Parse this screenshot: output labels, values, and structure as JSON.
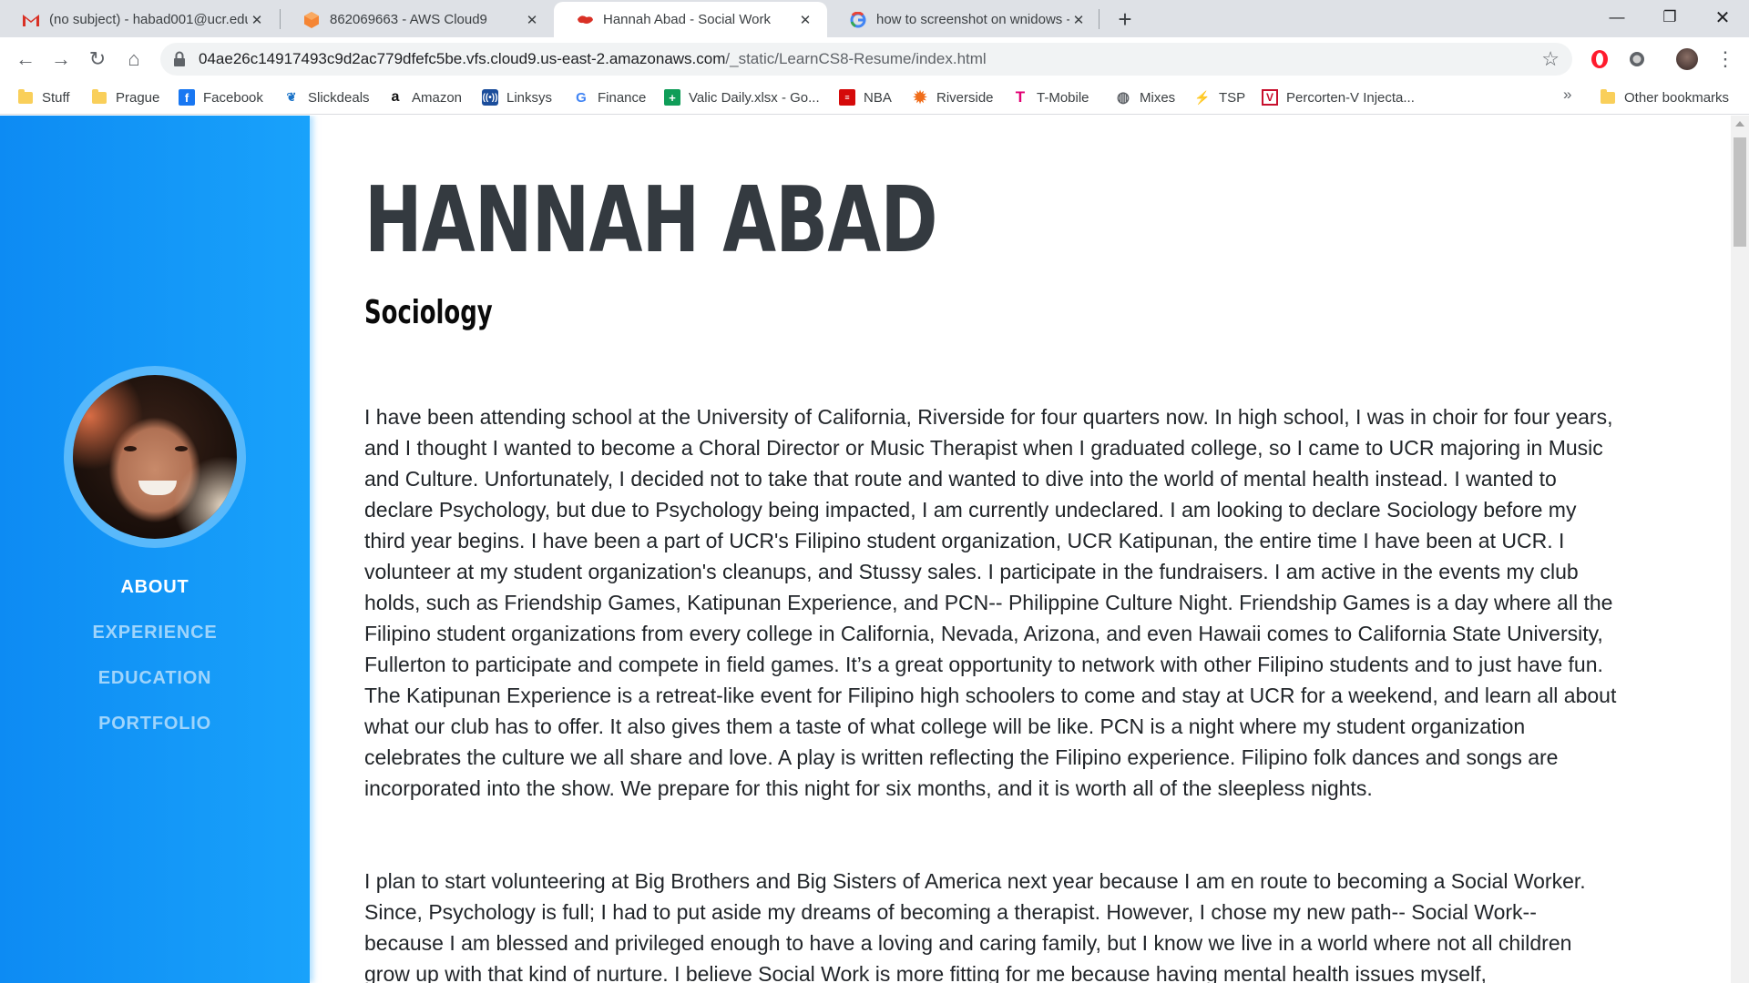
{
  "browser": {
    "tabs": [
      {
        "title": "(no subject) - habad001@ucr.edu",
        "icon": "gmail-icon"
      },
      {
        "title": "862069663 - AWS Cloud9",
        "icon": "cloud9-icon"
      },
      {
        "title": "Hannah Abad - Social Work",
        "icon": "site-favicon"
      },
      {
        "title": "how to screenshot on wnidows - ",
        "icon": "google-icon"
      }
    ],
    "url_host": "04ae26c14917493c9d2ac779dfefc5be.vfs.cloud9.us-east-2.amazonaws.com",
    "url_path": "/_static/LearnCS8-Resume/index.html",
    "bookmarks": [
      {
        "label": "Stuff",
        "icon": "folder-icon"
      },
      {
        "label": "Prague",
        "icon": "folder-icon"
      },
      {
        "label": "Facebook",
        "icon": "facebook-icon"
      },
      {
        "label": "Slickdeals",
        "icon": "slickdeals-icon"
      },
      {
        "label": "Amazon",
        "icon": "amazon-icon"
      },
      {
        "label": "Linksys",
        "icon": "linksys-icon"
      },
      {
        "label": "Finance",
        "icon": "google-icon"
      },
      {
        "label": "Valic Daily.xlsx - Go...",
        "icon": "sheets-icon"
      },
      {
        "label": "NBA",
        "icon": "nba-icon"
      },
      {
        "label": "Riverside",
        "icon": "riverside-icon"
      },
      {
        "label": "T-Mobile",
        "icon": "tmobile-icon"
      },
      {
        "label": "Mixes",
        "icon": "globe-icon"
      },
      {
        "label": "TSP",
        "icon": "tsp-icon"
      },
      {
        "label": "Percorten-V Injecta...",
        "icon": "percorten-icon"
      }
    ],
    "other_bookmarks": "Other bookmarks",
    "overflow": "»"
  },
  "sidebar": {
    "nav": [
      {
        "label": "ABOUT",
        "active": true
      },
      {
        "label": "EXPERIENCE",
        "active": false
      },
      {
        "label": "EDUCATION",
        "active": false
      },
      {
        "label": "PORTFOLIO",
        "active": false
      }
    ]
  },
  "main": {
    "name": "HANNAH ABAD",
    "subtitle": "Sociology",
    "paragraphs": [
      "I have been attending school at the University of California, Riverside for four quarters now. In high school, I was in choir for four years, and I thought I wanted to become a Choral Director or Music Therapist when I graduated college, so I came to UCR majoring in Music and Culture. Unfortunately, I decided not to take that route and wanted to dive into the world of mental health instead. I wanted to declare Psychology, but due to Psychology being impacted, I am currently undeclared. I am looking to declare Sociology before my third year begins. I have been a part of UCR's Filipino student organization, UCR Katipunan, the entire time I have been at UCR. I volunteer at my student organization's cleanups, and Stussy sales. I participate in the fundraisers. I am active in the events my club holds, such as Friendship Games, Katipunan Experience, and PCN-- Philippine Culture Night. Friendship Games is a day where all the Filipino student organizations from every college in California, Nevada, Arizona, and even Hawaii comes to California State University, Fullerton to participate and compete in field games. It’s a great opportunity to network with other Filipino students and to just have fun. The Katipunan Experience is a retreat-like event for Filipino high schoolers to come and stay at UCR for a weekend, and learn all about what our club has to offer. It also gives them a taste of what college will be like. PCN is a night where my student organization celebrates the culture we all share and love. A play is written reflecting the Filipino experience. Filipino folk dances and songs are incorporated into the show. We prepare for this night for six months, and it is worth all of the sleepless nights.",
      "I plan to start volunteering at Big Brothers and Big Sisters of America next year because I am en route to becoming a Social Worker. Since, Psychology is full; I had to put aside my dreams of becoming a therapist. However, I chose my new path-- Social Work-- because I am blessed and privileged enough to have a loving and caring family, but I know we live in a world where not all children grow up with that kind of nurture. I believe Social Work is more fitting for me because having mental health issues myself,"
    ]
  },
  "colors": {
    "sidebar_start": "#0d8bf3",
    "sidebar_end": "#19a2fb",
    "nav_active": "#ffffff",
    "nav_inactive": "#9fd4fb",
    "heading": "#343a40"
  }
}
